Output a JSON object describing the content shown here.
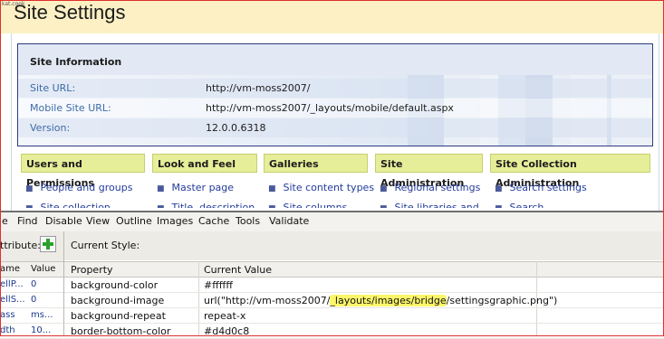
{
  "page": {
    "corner_note": "kat.cook",
    "title": "Site Settings"
  },
  "site_info": {
    "heading": "Site Information",
    "rows": [
      {
        "label": "Site URL:",
        "value": "http://vm-moss2007/"
      },
      {
        "label": "Mobile Site URL:",
        "value": "http://vm-moss2007/_layouts/mobile/default.aspx"
      },
      {
        "label": "Version:",
        "value": "12.0.0.6318"
      }
    ]
  },
  "sections": [
    {
      "title": "Users and Permissions",
      "link1": "People and groups",
      "link2": "Site collection"
    },
    {
      "title": "Look and Feel",
      "link1": "Master page",
      "link2": "Title, description"
    },
    {
      "title": "Galleries",
      "link1": "Site content types",
      "link2": "Site columns"
    },
    {
      "title": "Site Administration",
      "link1": "Regional settings",
      "link2": "Site libraries and"
    },
    {
      "title": "Site Collection Administration",
      "link1": "Search settings",
      "link2": "Search"
    }
  ],
  "menubar": [
    "e",
    "Find",
    "Disable",
    "View",
    "Outline",
    "Images",
    "Cache",
    "Tools",
    "Validate"
  ],
  "attributes": {
    "label": "ttribute:",
    "columns": [
      "ame",
      "Value"
    ],
    "rows": [
      {
        "name": "ellP...",
        "value": "0"
      },
      {
        "name": "ellS...",
        "value": "0"
      },
      {
        "name": "ass",
        "value": "ms..."
      },
      {
        "name": "dth",
        "value": "10..."
      }
    ]
  },
  "current_style": {
    "label": "Current Style:",
    "columns": [
      "Property",
      "Current Value"
    ],
    "rows": [
      {
        "property": "background-color",
        "value": "#ffffff"
      },
      {
        "property": "background-image",
        "value_pre": "url(\"http://vm-moss2007/",
        "value_hl": "_layouts/images/bridge",
        "value_post": "/settingsgraphic.png\")"
      },
      {
        "property": "background-repeat",
        "value": "repeat-x"
      },
      {
        "property": "border-bottom-color",
        "value": "#d4d0c8"
      }
    ]
  },
  "colors": {
    "accent_tab": "#e7ee9a",
    "highlight": "#fbf66a",
    "link": "#233c9a",
    "frame_border": "#e0302c"
  }
}
